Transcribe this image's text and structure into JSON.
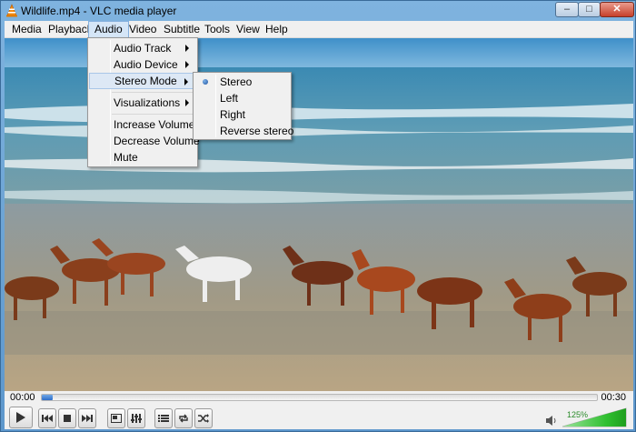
{
  "window": {
    "title": "Wildlife.mp4 - VLC media player",
    "buttons": {
      "minimize": "–",
      "maximize": "□",
      "close": "✕"
    }
  },
  "menubar": {
    "items": [
      "Media",
      "Playback",
      "Audio",
      "Video",
      "Subtitle",
      "Tools",
      "View",
      "Help"
    ],
    "active": "Audio"
  },
  "audio_menu": {
    "items": [
      {
        "label": "Audio Track",
        "submenu": true
      },
      {
        "label": "Audio Device",
        "submenu": true
      },
      {
        "label": "Stereo Mode",
        "submenu": true,
        "highlighted": true
      },
      {
        "label": "Visualizations",
        "submenu": true
      },
      {
        "label": "Increase Volume",
        "submenu": false
      },
      {
        "label": "Decrease Volume",
        "submenu": false
      },
      {
        "label": "Mute",
        "submenu": false
      }
    ]
  },
  "stereo_menu": {
    "items": [
      "Stereo",
      "Left",
      "Right",
      "Reverse stereo"
    ],
    "selected": "Stereo"
  },
  "playback": {
    "elapsed": "00:00",
    "total": "00:30",
    "progress_fraction": 0.02
  },
  "controls": {
    "icons": [
      "play-icon",
      "previous-icon",
      "stop-icon",
      "next-icon",
      "fullscreen-icon",
      "extended-settings-icon",
      "playlist-icon",
      "loop-icon",
      "shuffle-icon"
    ]
  },
  "volume": {
    "percent_label": "125%",
    "level_fraction": 1.0,
    "icon": "speaker-icon"
  },
  "colors": {
    "accent": "#2d6ec9",
    "volume_green": "#2fbf2f",
    "menu_bg": "#f0f0f0"
  }
}
